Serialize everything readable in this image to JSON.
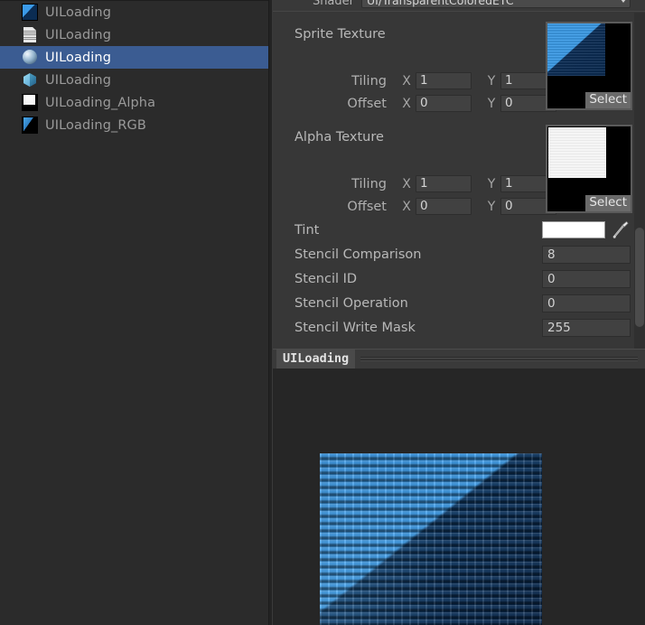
{
  "project_panel": {
    "items": [
      {
        "label": "UILoading",
        "icon": "texture-icon",
        "selected": false
      },
      {
        "label": "UILoading",
        "icon": "text-asset-icon",
        "selected": false
      },
      {
        "label": "UILoading",
        "icon": "material-sphere-icon",
        "selected": true
      },
      {
        "label": "UILoading",
        "icon": "prefab-cube-icon",
        "selected": false
      },
      {
        "label": "UILoading_Alpha",
        "icon": "alpha-texture-icon",
        "selected": false
      },
      {
        "label": "UILoading_RGB",
        "icon": "rgb-texture-icon",
        "selected": false
      }
    ],
    "selection_color": "#3b5c92"
  },
  "inspector": {
    "shader": {
      "label": "Shader",
      "value": "UI/TransparentColoredETC",
      "dropdown_icon": "chevron-down-icon"
    },
    "sprite_texture": {
      "title": "Sprite Texture",
      "tiling_label": "Tiling",
      "offset_label": "Offset",
      "x_tag": "X",
      "y_tag": "Y",
      "tiling_x": "1",
      "tiling_y": "1",
      "offset_x": "0",
      "offset_y": "0",
      "select_label": "Select"
    },
    "alpha_texture": {
      "title": "Alpha Texture",
      "tiling_label": "Tiling",
      "offset_label": "Offset",
      "x_tag": "X",
      "y_tag": "Y",
      "tiling_x": "1",
      "tiling_y": "1",
      "offset_x": "0",
      "offset_y": "0",
      "select_label": "Select"
    },
    "tint": {
      "label": "Tint",
      "color": "#ffffff",
      "eyedropper_icon": "eyedropper-icon"
    },
    "properties": [
      {
        "label": "Stencil Comparison",
        "value": "8"
      },
      {
        "label": "Stencil ID",
        "value": "0"
      },
      {
        "label": "Stencil Operation",
        "value": "0"
      },
      {
        "label": "Stencil Write Mask",
        "value": "255"
      }
    ]
  },
  "preview": {
    "title": "UILoading",
    "background_color": "#262626"
  }
}
